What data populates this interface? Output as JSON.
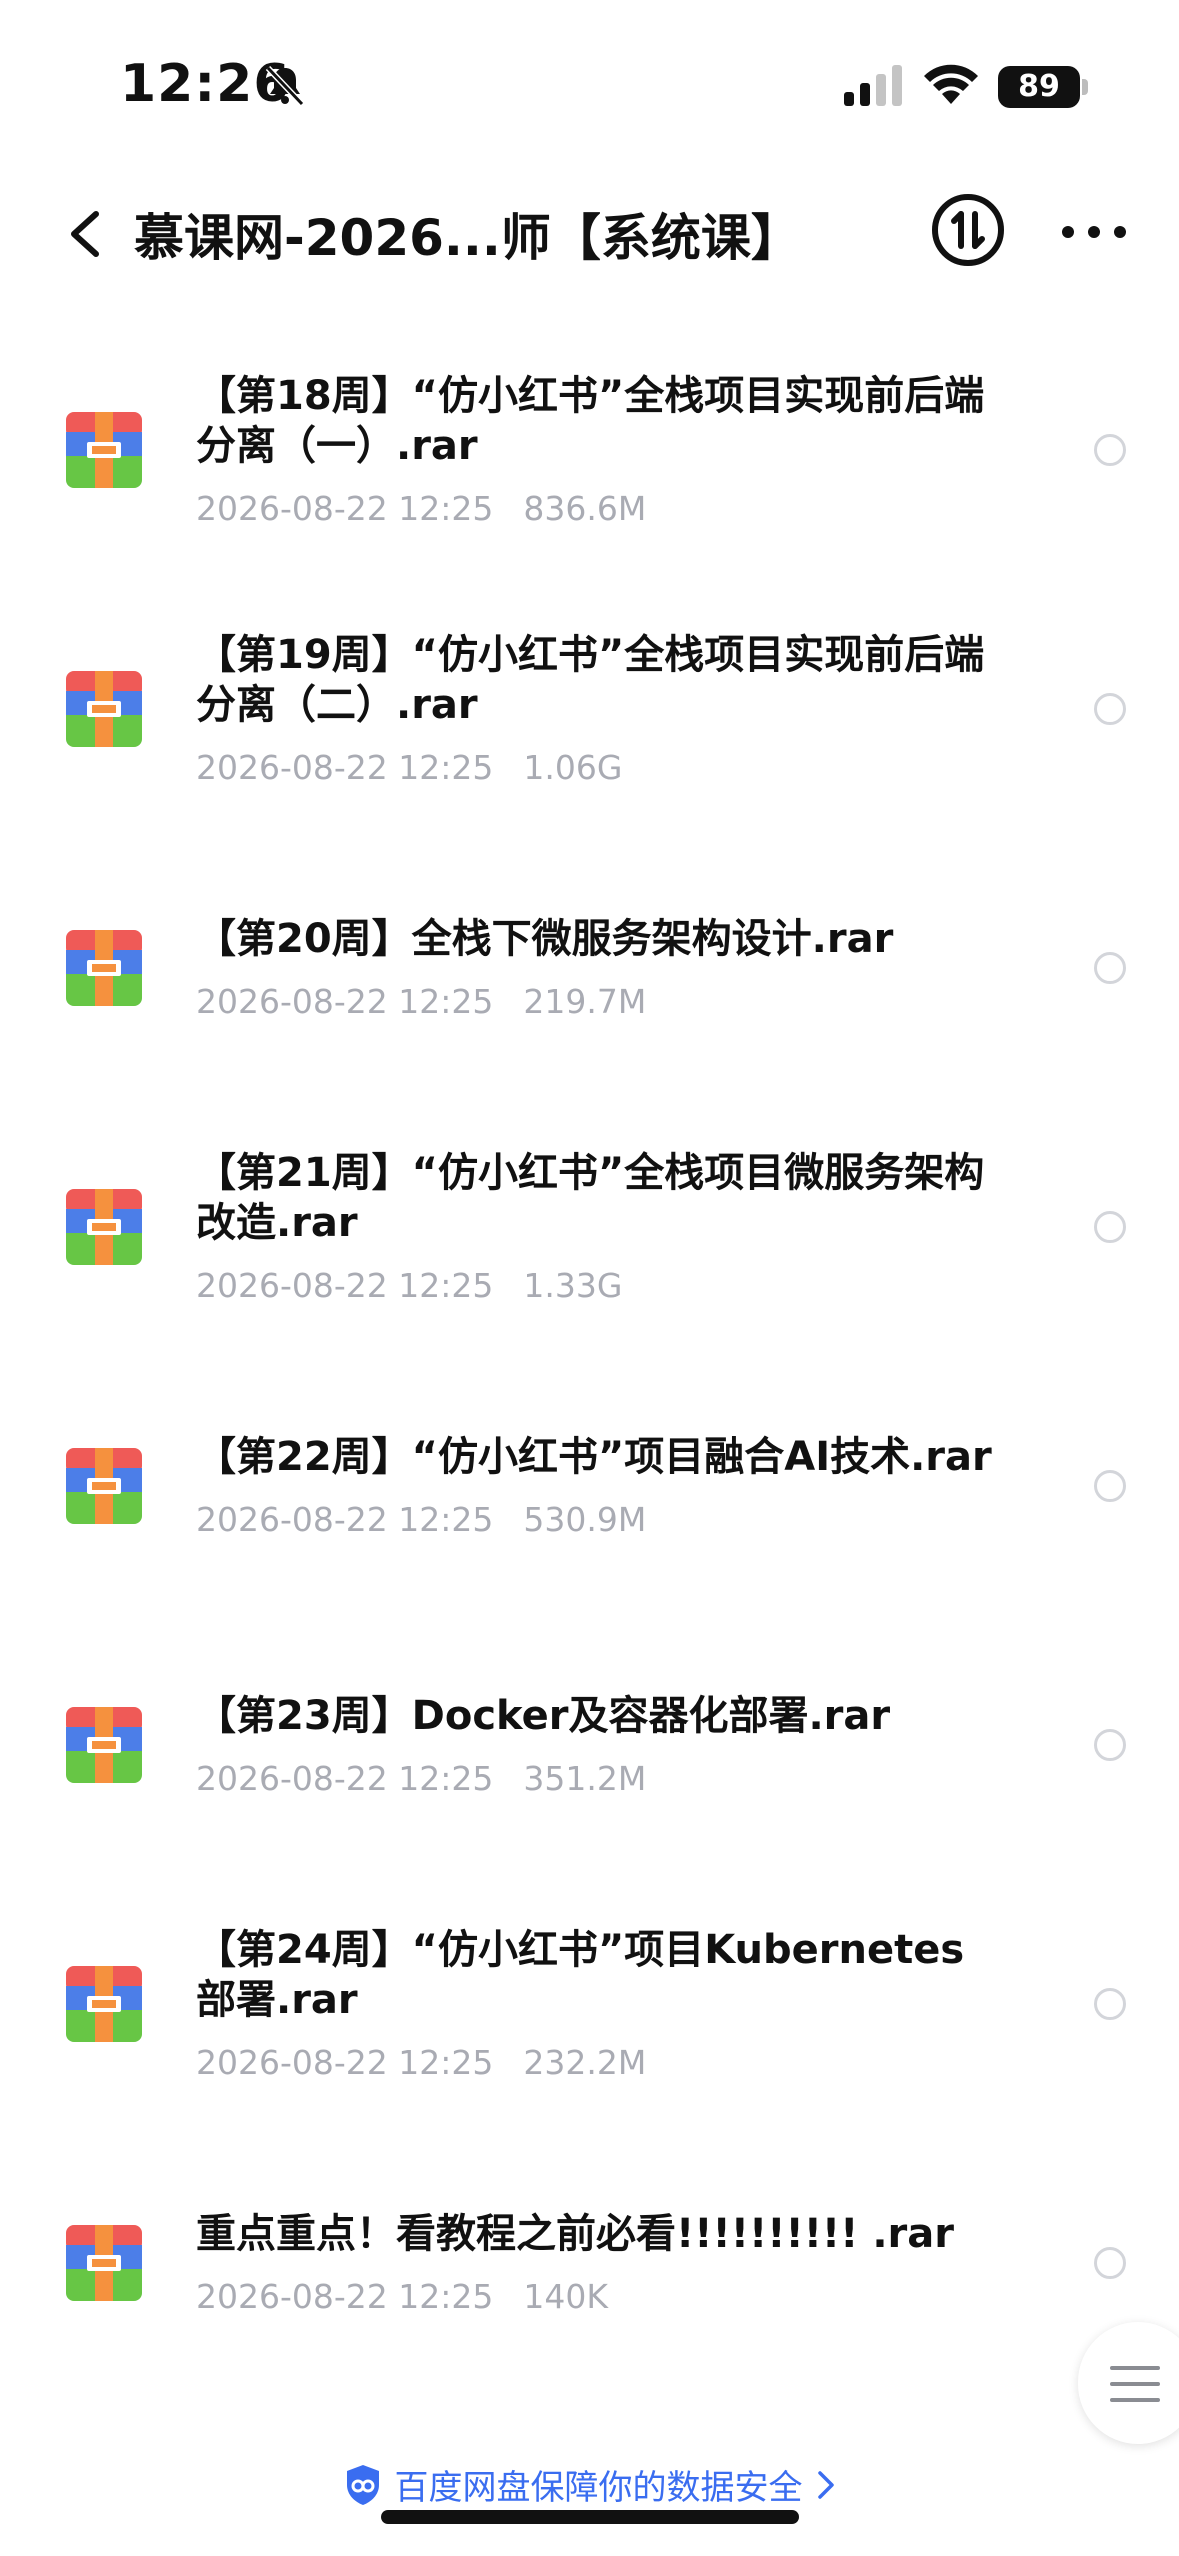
{
  "status_bar": {
    "time": "12:26",
    "battery": "89"
  },
  "nav": {
    "title": "慕课网-2026...师【系统课】"
  },
  "files": [
    {
      "name": "【第18周】“仿小红书”全栈项目实现前后端分离（一）.rar",
      "date": "2026-08-22 12:25",
      "size": "836.6M"
    },
    {
      "name": "【第19周】“仿小红书”全栈项目实现前后端分离（二）.rar",
      "date": "2026-08-22 12:25",
      "size": "1.06G"
    },
    {
      "name": "【第20周】全栈下微服务架构设计.rar",
      "date": "2026-08-22 12:25",
      "size": "219.7M"
    },
    {
      "name": "【第21周】“仿小红书”全栈项目微服务架构改造.rar",
      "date": "2026-08-22 12:25",
      "size": "1.33G"
    },
    {
      "name": "【第22周】“仿小红书”项目融合AI技术.rar",
      "date": "2026-08-22 12:25",
      "size": "530.9M"
    },
    {
      "name": "【第23周】Docker及容器化部署.rar",
      "date": "2026-08-22 12:25",
      "size": "351.2M"
    },
    {
      "name": "【第24周】“仿小红书”项目Kubernetes部署.rar",
      "date": "2026-08-22 12:25",
      "size": "232.2M"
    },
    {
      "name": "重点重点！看教程之前必看!!!!!!!!!! .rar",
      "date": "2026-08-22 12:25",
      "size": "140K"
    }
  ],
  "footer": {
    "text": "百度网盘保障你的数据安全"
  },
  "colors": {
    "accent": "#3a6df0",
    "meta_gray": "#a9abb3"
  }
}
